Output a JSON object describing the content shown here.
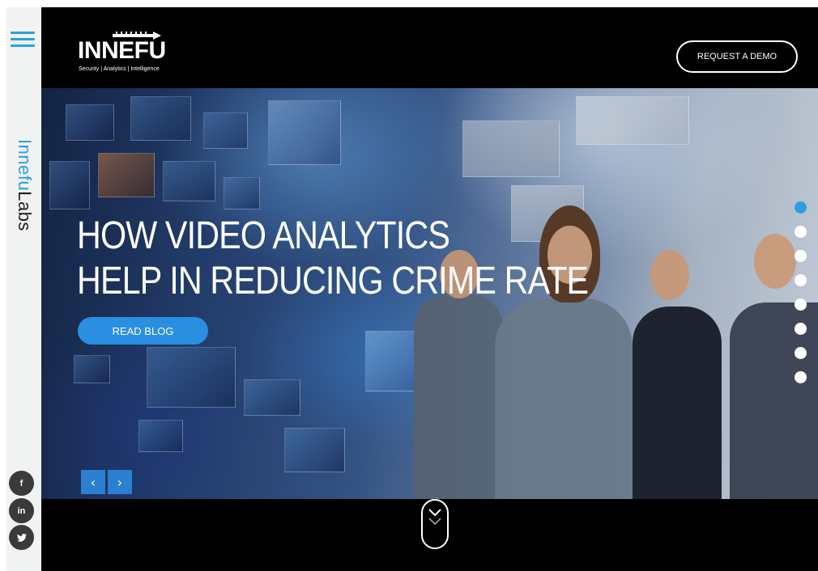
{
  "sidebar": {
    "menu_icon": "hamburger-icon",
    "brand_part1": "Innefu",
    "brand_part2": "Labs",
    "social": [
      {
        "label": "f",
        "icon": "facebook-icon"
      },
      {
        "label": "in",
        "icon": "linkedin-icon"
      },
      {
        "label": "t",
        "icon": "twitter-icon"
      }
    ]
  },
  "header": {
    "logo_text": "INNEFU",
    "logo_tagline": "Security | Analytics | Intelligence",
    "cta_label": "REQUEST A DEMO"
  },
  "hero": {
    "headline_line1": "HOW VIDEO ANALYTICS",
    "headline_line2": "HELP IN REDUCING CRIME RATE",
    "button_label": "READ BLOG",
    "prev_label": "‹",
    "next_label": "›",
    "slide_count": 8,
    "active_slide": 1
  },
  "colors": {
    "accent": "#2a9fe0",
    "button": "#2a8fe0",
    "background": "#000000"
  }
}
